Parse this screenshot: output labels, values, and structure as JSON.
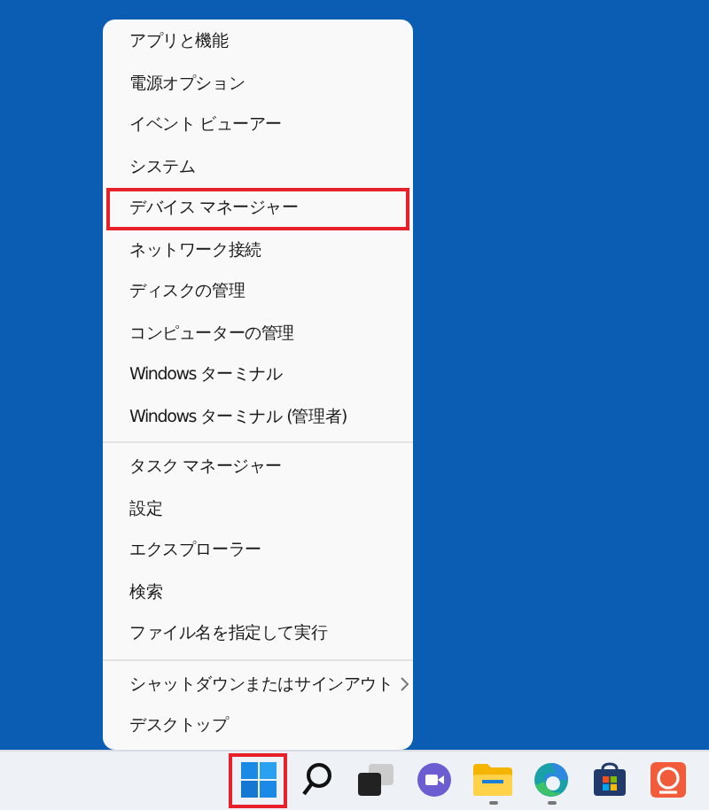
{
  "context_menu": {
    "groups": [
      {
        "items": [
          {
            "label": "アプリと機能",
            "highlighted": false,
            "has_submenu": false
          },
          {
            "label": "電源オプション",
            "highlighted": false,
            "has_submenu": false
          },
          {
            "label": "イベント ビューアー",
            "highlighted": false,
            "has_submenu": false
          },
          {
            "label": "システム",
            "highlighted": false,
            "has_submenu": false
          },
          {
            "label": "デバイス マネージャー",
            "highlighted": true,
            "has_submenu": false
          },
          {
            "label": "ネットワーク接続",
            "highlighted": false,
            "has_submenu": false
          },
          {
            "label": "ディスクの管理",
            "highlighted": false,
            "has_submenu": false
          },
          {
            "label": "コンピューターの管理",
            "highlighted": false,
            "has_submenu": false
          },
          {
            "label": "Windows ターミナル",
            "highlighted": false,
            "has_submenu": false
          },
          {
            "label": "Windows ターミナル (管理者)",
            "highlighted": false,
            "has_submenu": false
          }
        ]
      },
      {
        "items": [
          {
            "label": "タスク マネージャー",
            "highlighted": false,
            "has_submenu": false
          },
          {
            "label": "設定",
            "highlighted": false,
            "has_submenu": false
          },
          {
            "label": "エクスプローラー",
            "highlighted": false,
            "has_submenu": false
          },
          {
            "label": "検索",
            "highlighted": false,
            "has_submenu": false
          },
          {
            "label": "ファイル名を指定して実行",
            "highlighted": false,
            "has_submenu": false
          }
        ]
      },
      {
        "items": [
          {
            "label": "シャットダウンまたはサインアウト",
            "highlighted": false,
            "has_submenu": true
          },
          {
            "label": "デスクトップ",
            "highlighted": false,
            "has_submenu": false
          }
        ]
      }
    ]
  },
  "taskbar": {
    "icons": [
      {
        "kind": "start",
        "highlighted": true,
        "running": false
      },
      {
        "kind": "search",
        "highlighted": false,
        "running": false
      },
      {
        "kind": "taskview",
        "highlighted": false,
        "running": false
      },
      {
        "kind": "chat",
        "highlighted": false,
        "running": false
      },
      {
        "kind": "folder",
        "highlighted": false,
        "running": true
      },
      {
        "kind": "edge",
        "highlighted": false,
        "running": true
      },
      {
        "kind": "store",
        "highlighted": false,
        "running": false
      },
      {
        "kind": "app",
        "highlighted": false,
        "running": false
      }
    ]
  }
}
